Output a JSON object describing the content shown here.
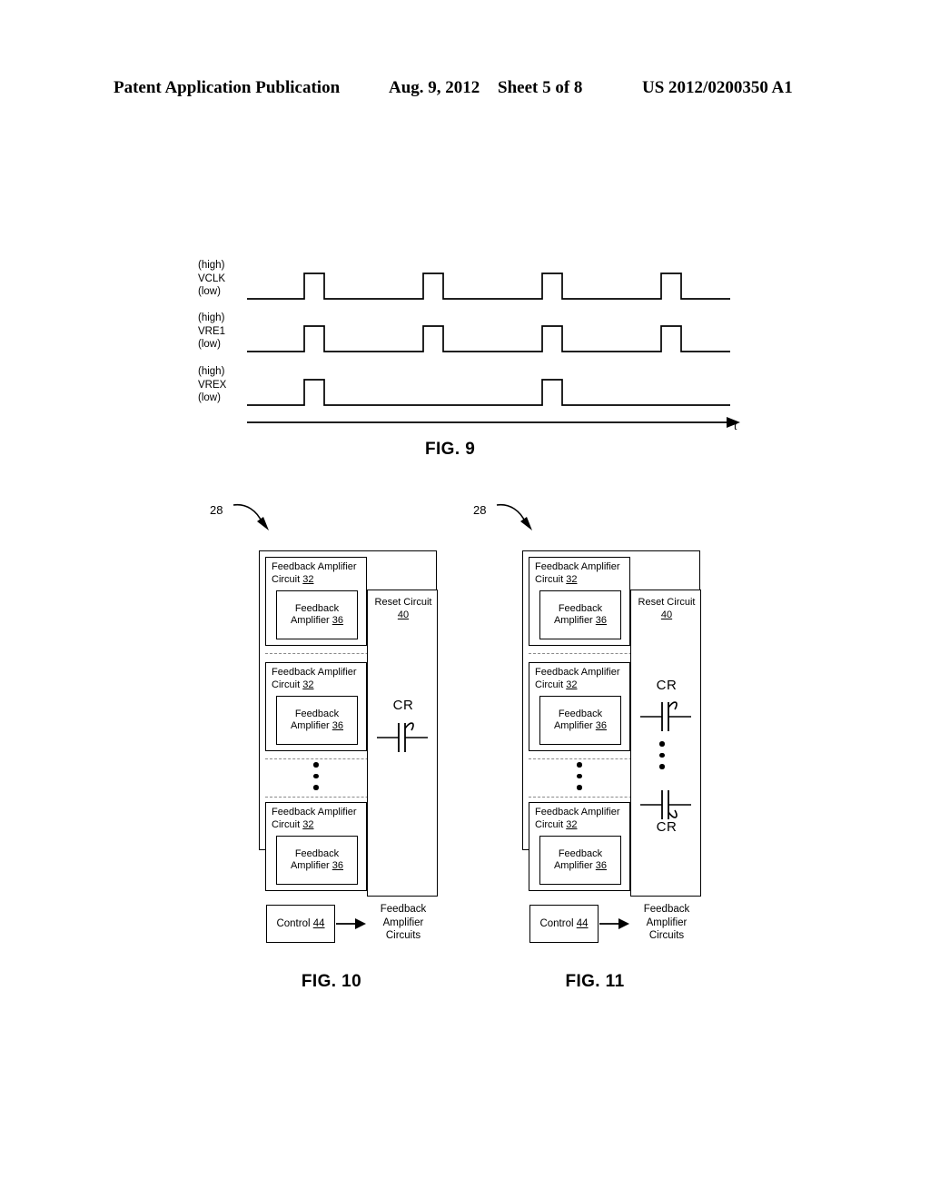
{
  "header": {
    "publication": "Patent Application Publication",
    "date": "Aug. 9, 2012",
    "sheet": "Sheet 5 of 8",
    "number": "US 2012/0200350 A1"
  },
  "fig9": {
    "caption": "FIG. 9",
    "time_axis_label": "t",
    "high_label": "(high)",
    "low_label": "(low)",
    "signals": [
      {
        "name": "VCLK",
        "high_label": "(high)",
        "low_label": "(low)",
        "pulses": [
          1,
          2,
          3,
          4
        ]
      },
      {
        "name": "VRE1",
        "high_label": "(high)",
        "low_label": "(low)",
        "pulses": [
          1,
          2,
          3,
          4
        ]
      },
      {
        "name": "VREX",
        "high_label": "(high)",
        "low_label": "(low)",
        "pulses": [
          1,
          3
        ]
      }
    ]
  },
  "fig10": {
    "caption": "FIG. 10",
    "reference_number": "28",
    "cells": [
      {
        "title_line1": "Feedback Amplifier",
        "title_line2": "Circuit",
        "title_ref": "32",
        "inner_line1": "Feedback",
        "inner_line2": "Amplifier",
        "inner_ref": "36"
      },
      {
        "title_line1": "Feedback Amplifier",
        "title_line2": "Circuit",
        "title_ref": "32",
        "inner_line1": "Feedback",
        "inner_line2": "Amplifier",
        "inner_ref": "36"
      },
      {
        "title_line1": "Feedback Amplifier",
        "title_line2": "Circuit",
        "title_ref": "32",
        "inner_line1": "Feedback",
        "inner_line2": "Amplifier",
        "inner_ref": "36"
      }
    ],
    "reset_circuit": {
      "line1": "Reset Circuit",
      "ref": "40"
    },
    "capacitors": [
      {
        "label": "CR",
        "label_position": "above"
      }
    ],
    "control": {
      "label": "Control",
      "ref": "44"
    },
    "control_target": {
      "line1": "Feedback",
      "line2": "Amplifier",
      "line3": "Circuits"
    }
  },
  "fig11": {
    "caption": "FIG. 11",
    "reference_number": "28",
    "cells": [
      {
        "title_line1": "Feedback Amplifier",
        "title_line2": "Circuit",
        "title_ref": "32",
        "inner_line1": "Feedback",
        "inner_line2": "Amplifier",
        "inner_ref": "36"
      },
      {
        "title_line1": "Feedback Amplifier",
        "title_line2": "Circuit",
        "title_ref": "32",
        "inner_line1": "Feedback",
        "inner_line2": "Amplifier",
        "inner_ref": "36"
      },
      {
        "title_line1": "Feedback Amplifier",
        "title_line2": "Circuit",
        "title_ref": "32",
        "inner_line1": "Feedback",
        "inner_line2": "Amplifier",
        "inner_ref": "36"
      }
    ],
    "reset_circuit": {
      "line1": "Reset Circuit",
      "ref": "40"
    },
    "capacitors": [
      {
        "label": "CR",
        "label_position": "above"
      },
      {
        "label": "CR",
        "label_position": "below"
      }
    ],
    "control": {
      "label": "Control",
      "ref": "44"
    },
    "control_target": {
      "line1": "Feedback",
      "line2": "Amplifier",
      "line3": "Circuits"
    }
  },
  "colors": {
    "ink": "#000000",
    "paper": "#ffffff",
    "dashed_separator": "#8a8a8a"
  }
}
